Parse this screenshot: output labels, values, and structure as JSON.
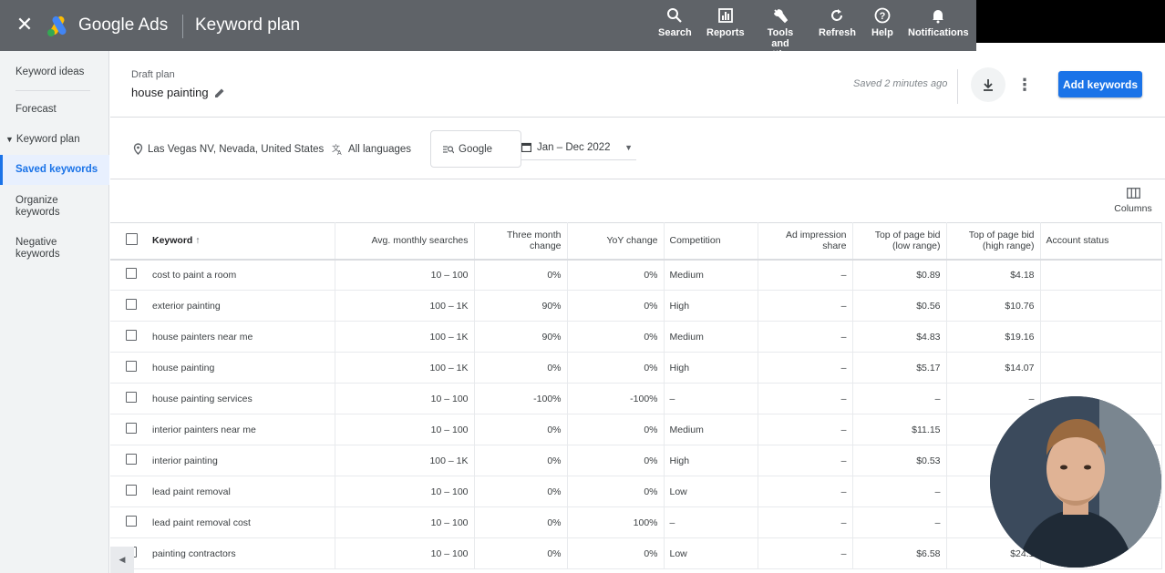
{
  "app": {
    "brand": "Google Ads",
    "page_title": "Keyword plan"
  },
  "toolbar": {
    "search": "Search",
    "reports": "Reports",
    "tools": "Tools and settings",
    "refresh": "Refresh",
    "help": "Help",
    "notifications": "Notifications"
  },
  "sidebar": {
    "items": [
      {
        "label": "Keyword ideas"
      },
      {
        "label": "Forecast"
      },
      {
        "label": "Keyword plan"
      },
      {
        "label": "Saved keywords"
      },
      {
        "label": "Organize keywords"
      },
      {
        "label": "Negative keywords"
      }
    ]
  },
  "header": {
    "draft_label": "Draft plan",
    "plan_name": "house painting",
    "saved_status": "Saved 2 minutes ago",
    "add_keywords": "Add keywords"
  },
  "filters": {
    "location": "Las Vegas NV, Nevada, United States",
    "language": "All languages",
    "network": "Google",
    "date_range": "Jan – Dec 2022"
  },
  "table": {
    "columns_label": "Columns",
    "headers": {
      "keyword": "Keyword",
      "avg_monthly": "Avg. monthly searches",
      "three_month": "Three month change",
      "yoy": "YoY change",
      "competition": "Competition",
      "ad_impression": "Ad impression share",
      "bid_low": "Top of page bid (low range)",
      "bid_high": "Top of page bid (high range)",
      "account_status": "Account status"
    },
    "rows": [
      {
        "keyword": "cost to paint a room",
        "avg": "10 – 100",
        "three": "0%",
        "yoy": "0%",
        "comp": "Medium",
        "imp": "–",
        "low": "$0.89",
        "high": "$4.18"
      },
      {
        "keyword": "exterior painting",
        "avg": "100 – 1K",
        "three": "90%",
        "yoy": "0%",
        "comp": "High",
        "imp": "–",
        "low": "$0.56",
        "high": "$10.76"
      },
      {
        "keyword": "house painters near me",
        "avg": "100 – 1K",
        "three": "90%",
        "yoy": "0%",
        "comp": "Medium",
        "imp": "–",
        "low": "$4.83",
        "high": "$19.16"
      },
      {
        "keyword": "house painting",
        "avg": "100 – 1K",
        "three": "0%",
        "yoy": "0%",
        "comp": "High",
        "imp": "–",
        "low": "$5.17",
        "high": "$14.07"
      },
      {
        "keyword": "house painting services",
        "avg": "10 – 100",
        "three": "-100%",
        "yoy": "-100%",
        "comp": "–",
        "imp": "–",
        "low": "–",
        "high": "–"
      },
      {
        "keyword": "interior painters near me",
        "avg": "10 – 100",
        "three": "0%",
        "yoy": "0%",
        "comp": "Medium",
        "imp": "–",
        "low": "$11.15",
        "high": ""
      },
      {
        "keyword": "interior painting",
        "avg": "100 – 1K",
        "three": "0%",
        "yoy": "0%",
        "comp": "High",
        "imp": "–",
        "low": "$0.53",
        "high": ""
      },
      {
        "keyword": "lead paint removal",
        "avg": "10 – 100",
        "three": "0%",
        "yoy": "0%",
        "comp": "Low",
        "imp": "–",
        "low": "–",
        "high": ""
      },
      {
        "keyword": "lead paint removal cost",
        "avg": "10 – 100",
        "three": "0%",
        "yoy": "100%",
        "comp": "–",
        "imp": "–",
        "low": "–",
        "high": ""
      },
      {
        "keyword": "painting contractors",
        "avg": "10 – 100",
        "three": "0%",
        "yoy": "0%",
        "comp": "Low",
        "imp": "–",
        "low": "$6.58",
        "high": "$24.1"
      }
    ]
  },
  "colors": {
    "topbar": "#5f6368",
    "accent": "#1a73e8",
    "sidebar_bg": "#f1f3f4"
  }
}
